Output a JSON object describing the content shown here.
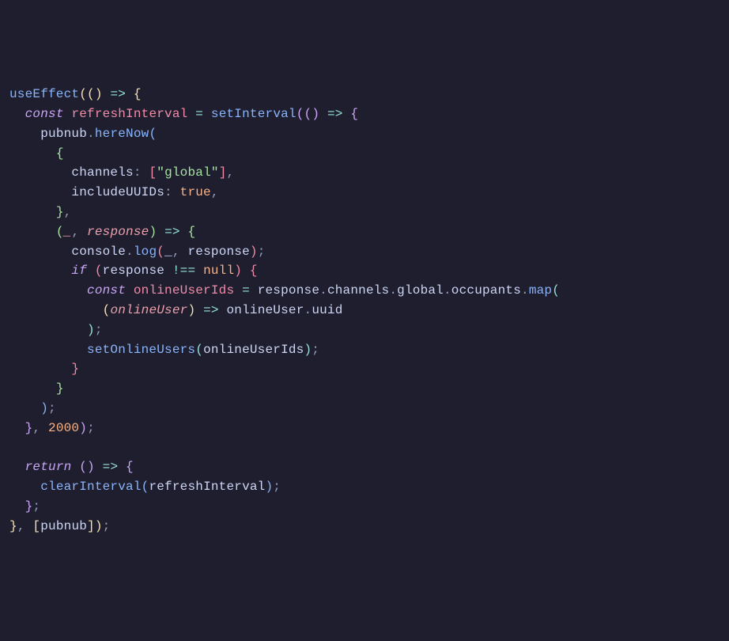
{
  "code": {
    "lines": [
      {
        "indent": 0,
        "tokens": [
          {
            "t": "useEffect",
            "c": "fn-call"
          },
          {
            "t": "((",
            "c": "paren-y"
          },
          {
            "t": ") ",
            "c": "paren-y"
          },
          {
            "t": "=>",
            "c": "op"
          },
          {
            "t": " {",
            "c": "paren-y"
          }
        ]
      },
      {
        "indent": 1,
        "tokens": [
          {
            "t": "const",
            "c": "const-kw"
          },
          {
            "t": " ",
            "c": "text"
          },
          {
            "t": "refreshInterval",
            "c": "var-decl"
          },
          {
            "t": " ",
            "c": "text"
          },
          {
            "t": "=",
            "c": "op"
          },
          {
            "t": " ",
            "c": "text"
          },
          {
            "t": "setInterval",
            "c": "fn-call"
          },
          {
            "t": "((",
            "c": "paren-p"
          },
          {
            "t": ") ",
            "c": "paren-p"
          },
          {
            "t": "=>",
            "c": "op"
          },
          {
            "t": " {",
            "c": "paren-p"
          }
        ]
      },
      {
        "indent": 2,
        "tokens": [
          {
            "t": "pubnub",
            "c": "text"
          },
          {
            "t": ".",
            "c": "punc"
          },
          {
            "t": "hereNow",
            "c": "fn-call"
          },
          {
            "t": "(",
            "c": "paren-b"
          }
        ]
      },
      {
        "indent": 3,
        "tokens": [
          {
            "t": "{",
            "c": "paren-g"
          }
        ]
      },
      {
        "indent": 4,
        "tokens": [
          {
            "t": "channels",
            "c": "text"
          },
          {
            "t": ": ",
            "c": "punc"
          },
          {
            "t": "[",
            "c": "paren-r"
          },
          {
            "t": "\"global\"",
            "c": "str"
          },
          {
            "t": "]",
            "c": "paren-r"
          },
          {
            "t": ",",
            "c": "punc"
          }
        ]
      },
      {
        "indent": 4,
        "tokens": [
          {
            "t": "includeUUIDs",
            "c": "text"
          },
          {
            "t": ": ",
            "c": "punc"
          },
          {
            "t": "true",
            "c": "bool"
          },
          {
            "t": ",",
            "c": "punc"
          }
        ]
      },
      {
        "indent": 3,
        "tokens": [
          {
            "t": "}",
            "c": "paren-g"
          },
          {
            "t": ",",
            "c": "punc"
          }
        ]
      },
      {
        "indent": 3,
        "tokens": [
          {
            "t": "(",
            "c": "paren-g"
          },
          {
            "t": "_",
            "c": "param"
          },
          {
            "t": ", ",
            "c": "punc"
          },
          {
            "t": "response",
            "c": "param"
          },
          {
            "t": ") ",
            "c": "paren-g"
          },
          {
            "t": "=>",
            "c": "op"
          },
          {
            "t": " {",
            "c": "paren-g"
          }
        ]
      },
      {
        "indent": 4,
        "tokens": [
          {
            "t": "console",
            "c": "text"
          },
          {
            "t": ".",
            "c": "punc"
          },
          {
            "t": "log",
            "c": "fn-call"
          },
          {
            "t": "(",
            "c": "paren-r"
          },
          {
            "t": "_",
            "c": "text"
          },
          {
            "t": ", ",
            "c": "punc"
          },
          {
            "t": "response",
            "c": "text"
          },
          {
            "t": ")",
            "c": "paren-r"
          },
          {
            "t": ";",
            "c": "punc"
          }
        ]
      },
      {
        "indent": 4,
        "tokens": [
          {
            "t": "if",
            "c": "kw-ital"
          },
          {
            "t": " (",
            "c": "paren-r"
          },
          {
            "t": "response ",
            "c": "text"
          },
          {
            "t": "!==",
            "c": "op"
          },
          {
            "t": " ",
            "c": "text"
          },
          {
            "t": "null",
            "c": "null"
          },
          {
            "t": ") ",
            "c": "paren-r"
          },
          {
            "t": "{",
            "c": "paren-r"
          }
        ]
      },
      {
        "indent": 5,
        "tokens": [
          {
            "t": "const",
            "c": "const-kw"
          },
          {
            "t": " ",
            "c": "text"
          },
          {
            "t": "onlineUserIds",
            "c": "var-decl"
          },
          {
            "t": " ",
            "c": "text"
          },
          {
            "t": "=",
            "c": "op"
          },
          {
            "t": " ",
            "c": "text"
          },
          {
            "t": "response",
            "c": "text"
          },
          {
            "t": ".",
            "c": "punc"
          },
          {
            "t": "channels",
            "c": "text"
          },
          {
            "t": ".",
            "c": "punc"
          },
          {
            "t": "global",
            "c": "text"
          },
          {
            "t": ".",
            "c": "punc"
          },
          {
            "t": "occupants",
            "c": "text"
          },
          {
            "t": ".",
            "c": "punc"
          },
          {
            "t": "map",
            "c": "fn-call"
          },
          {
            "t": "(",
            "c": "paren-t"
          }
        ]
      },
      {
        "indent": 6,
        "tokens": [
          {
            "t": "(",
            "c": "paren-y"
          },
          {
            "t": "onlineUser",
            "c": "param"
          },
          {
            "t": ") ",
            "c": "paren-y"
          },
          {
            "t": "=>",
            "c": "op"
          },
          {
            "t": " ",
            "c": "text"
          },
          {
            "t": "onlineUser",
            "c": "text"
          },
          {
            "t": ".",
            "c": "punc"
          },
          {
            "t": "uuid",
            "c": "text"
          }
        ]
      },
      {
        "indent": 5,
        "tokens": [
          {
            "t": ")",
            "c": "paren-t"
          },
          {
            "t": ";",
            "c": "punc"
          }
        ]
      },
      {
        "indent": 5,
        "tokens": [
          {
            "t": "setOnlineUsers",
            "c": "fn-call"
          },
          {
            "t": "(",
            "c": "paren-t"
          },
          {
            "t": "onlineUserIds",
            "c": "text"
          },
          {
            "t": ")",
            "c": "paren-t"
          },
          {
            "t": ";",
            "c": "punc"
          }
        ]
      },
      {
        "indent": 4,
        "tokens": [
          {
            "t": "}",
            "c": "paren-r"
          }
        ]
      },
      {
        "indent": 3,
        "tokens": [
          {
            "t": "}",
            "c": "paren-g"
          }
        ]
      },
      {
        "indent": 2,
        "tokens": [
          {
            "t": ")",
            "c": "paren-b"
          },
          {
            "t": ";",
            "c": "punc"
          }
        ]
      },
      {
        "indent": 1,
        "tokens": [
          {
            "t": "}",
            "c": "paren-p"
          },
          {
            "t": ", ",
            "c": "punc"
          },
          {
            "t": "2000",
            "c": "num"
          },
          {
            "t": ")",
            "c": "paren-p"
          },
          {
            "t": ";",
            "c": "punc"
          }
        ]
      },
      {
        "indent": 0,
        "tokens": []
      },
      {
        "indent": 1,
        "tokens": [
          {
            "t": "return",
            "c": "kw-ital"
          },
          {
            "t": " (",
            "c": "paren-p"
          },
          {
            "t": ") ",
            "c": "paren-p"
          },
          {
            "t": "=>",
            "c": "op"
          },
          {
            "t": " {",
            "c": "paren-p"
          }
        ]
      },
      {
        "indent": 2,
        "tokens": [
          {
            "t": "clearInterval",
            "c": "fn-call"
          },
          {
            "t": "(",
            "c": "paren-b"
          },
          {
            "t": "refreshInterval",
            "c": "text"
          },
          {
            "t": ")",
            "c": "paren-b"
          },
          {
            "t": ";",
            "c": "punc"
          }
        ]
      },
      {
        "indent": 1,
        "tokens": [
          {
            "t": "}",
            "c": "paren-p"
          },
          {
            "t": ";",
            "c": "punc"
          }
        ]
      },
      {
        "indent": 0,
        "tokens": [
          {
            "t": "}",
            "c": "paren-y"
          },
          {
            "t": ", ",
            "c": "punc"
          },
          {
            "t": "[",
            "c": "paren-y"
          },
          {
            "t": "pubnub",
            "c": "text"
          },
          {
            "t": "]",
            "c": "paren-y"
          },
          {
            "t": ")",
            "c": "paren-y"
          },
          {
            "t": ";",
            "c": "punc"
          }
        ]
      }
    ],
    "indentUnit": "  "
  }
}
